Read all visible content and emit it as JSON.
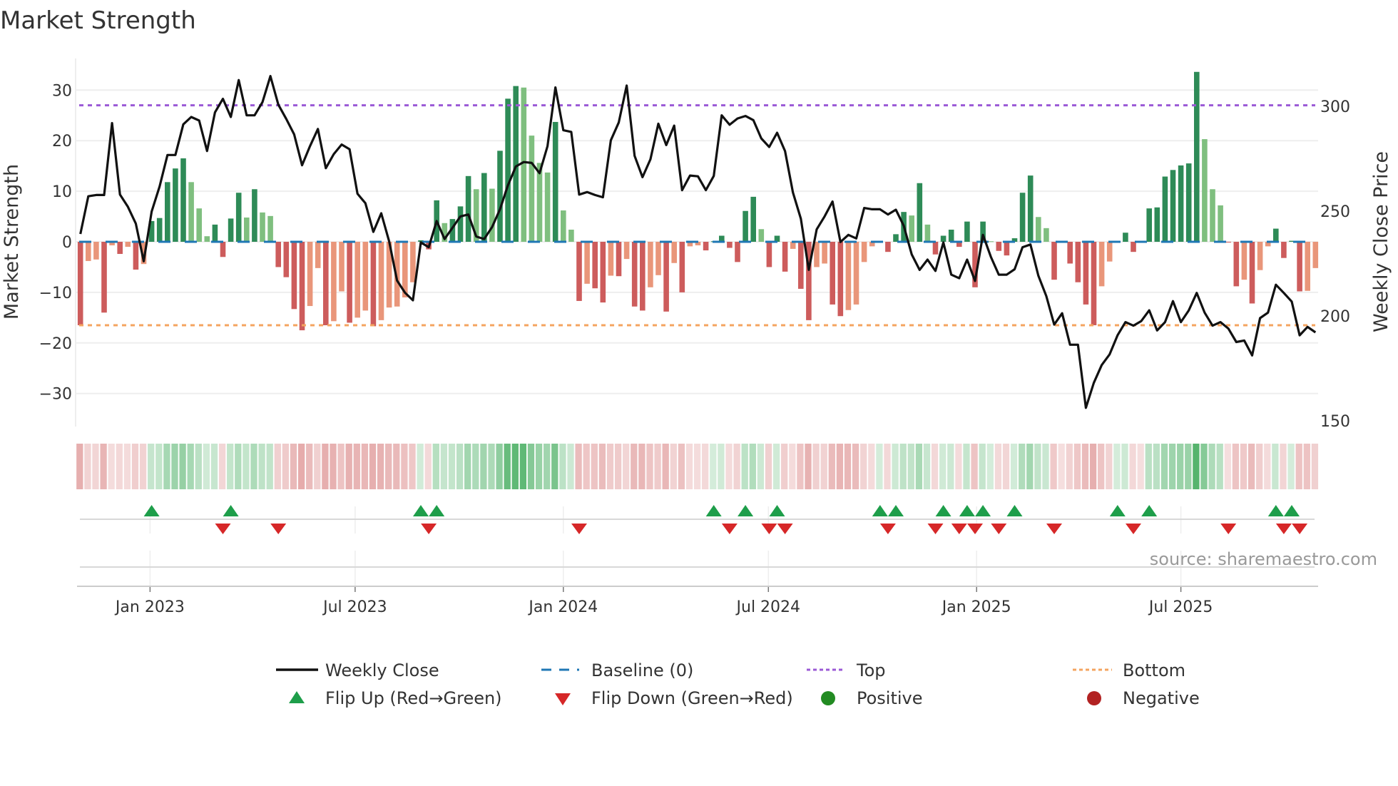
{
  "title": "Market Strength",
  "source": "source: sharemaestro.com",
  "colors": {
    "price": "#111111",
    "baseline": "#1f77b4",
    "top": "#9b59d6",
    "bottom": "#f4a460",
    "pos_strong": "#2e8b57",
    "pos_weak": "#7fbf7f",
    "neg_strong": "#cd5c5c",
    "neg_weak": "#e9967a",
    "flip_up": "#1e9e4a",
    "flip_down": "#d62728",
    "positive": "#228b22",
    "negative": "#b22222",
    "grid": "#eeeeee"
  },
  "legend": {
    "weekly_close": "Weekly Close",
    "baseline": "Baseline (0)",
    "top": "Top",
    "bottom": "Bottom",
    "flip_up": "Flip Up (Red→Green)",
    "flip_down": "Flip Down (Green→Red)",
    "positive": "Positive",
    "negative": "Negative"
  },
  "chart_data": {
    "type": "bar",
    "title": "Market Strength",
    "ylabel": "Market Strength",
    "y2label": "Weekly Close Price",
    "ylim": [
      -35,
      36
    ],
    "y2lim": [
      145,
      325
    ],
    "yticks": [
      "30",
      "20",
      "10",
      "0",
      "−10",
      "−20",
      "−30"
    ],
    "ytick_values": [
      30,
      20,
      10,
      0,
      -10,
      -20,
      -30
    ],
    "y2ticks": [
      "300",
      "250",
      "200",
      "150"
    ],
    "y2tick_values": [
      300,
      250,
      200,
      150
    ],
    "grid": true,
    "legend_placement": "bottom",
    "top_level": 27,
    "bottom_level": -16.5,
    "baseline": 0,
    "x_unit": "week index (weekly, ~Nov 2022 to Oct 2025)",
    "xticks": [
      {
        "label": "Jan 2023",
        "week": 8.8
      },
      {
        "label": "Jul 2023",
        "week": 34.7
      },
      {
        "label": "Jan 2024",
        "week": 61.0
      },
      {
        "label": "Jul 2024",
        "week": 86.9
      },
      {
        "label": "Jan 2025",
        "week": 113.2
      },
      {
        "label": "Jul 2025",
        "week": 139.0
      }
    ],
    "strength": [
      -16.5,
      -3.8,
      -3.5,
      -14,
      -0.7,
      -2.4,
      -1,
      -5.5,
      -4.4,
      4.1,
      4.7,
      11.8,
      14.5,
      16.5,
      11.8,
      6.6,
      1.1,
      3.4,
      -3,
      4.6,
      9.7,
      4.8,
      10.4,
      5.8,
      5.1,
      -5,
      -7,
      -13.3,
      -17.5,
      -12.7,
      -5.2,
      -16.5,
      -15.7,
      -9.8,
      -16,
      -15,
      -13.6,
      -16.7,
      -15.5,
      -13,
      -12.8,
      -11,
      -8,
      0.3,
      -1.5,
      8.2,
      3.7,
      4.5,
      7,
      13,
      10.4,
      13.6,
      10.5,
      18,
      28.3,
      30.8,
      30.5,
      21,
      15.6,
      13.7,
      23.7,
      6.2,
      2.4,
      -11.7,
      -8.3,
      -9.2,
      -12,
      -6.7,
      -6.8,
      -3.4,
      -12.8,
      -13.6,
      -9,
      -6.6,
      -13.8,
      -4.2,
      -10,
      -0.9,
      -0.7,
      -1.7,
      0.1,
      1.2,
      -1.2,
      -4,
      6.1,
      8.9,
      2.5,
      -5,
      1.2,
      -5.9,
      -1.4,
      -9.3,
      -15.5,
      -5,
      -4.3,
      -12.4,
      -14.7,
      -13.5,
      -12.4,
      -4,
      -0.9,
      0.2,
      -2,
      1.5,
      5.9,
      5.2,
      11.6,
      3.4,
      -2.5,
      1.2,
      2.4,
      -1,
      4,
      -9,
      4,
      0.1,
      -1.8,
      -2.7,
      0.7,
      9.7,
      13.1,
      4.9,
      2.7,
      -7.5,
      -0.1,
      -4.3,
      -8,
      -12.4,
      -16.5,
      -8.8,
      -3.9,
      0.1,
      1.8,
      -2,
      -0.1,
      6.6,
      6.8,
      12.9,
      14.2,
      15.1,
      15.5,
      33.6,
      20.3,
      10.4,
      7.2,
      -0.1,
      -8.8,
      -7.5,
      -12.2,
      -5.6,
      -0.9,
      2.6,
      -3.2,
      0.2,
      -9.8,
      -9.7,
      -5.2
    ],
    "weekly_close": [
      239,
      257,
      257.6,
      257.6,
      291.9,
      257.8,
      252,
      244,
      226,
      249.7,
      261.6,
      276.7,
      276.7,
      291.3,
      294.8,
      293.1,
      278.6,
      297,
      303.5,
      294.8,
      312.4,
      295.6,
      295.6,
      301.9,
      314.3,
      300.7,
      293.9,
      286.5,
      271.8,
      280.9,
      289.1,
      270.4,
      277.1,
      281.7,
      279.4,
      258.2,
      253.7,
      240,
      248.9,
      235.5,
      216.8,
      211,
      207.4,
      235,
      232.7,
      245.2,
      236.6,
      242,
      247.4,
      248.3,
      237.8,
      236.6,
      242.3,
      250.8,
      262.2,
      271.2,
      273.3,
      272.9,
      268,
      280.9,
      308.9,
      288.5,
      287.7,
      257.8,
      259,
      257.6,
      256.5,
      283.7,
      292.2,
      309.8,
      276.3,
      266.1,
      274.6,
      291.6,
      281.4,
      290.7,
      259.9,
      266.9,
      266.5,
      259.9,
      266.7,
      295.6,
      291.1,
      294.1,
      295.3,
      293.3,
      284.6,
      280.5,
      287.3,
      278.6,
      258.8,
      246.3,
      221.9,
      241.2,
      247.4,
      254.5,
      235.2,
      238.6,
      236.9,
      251.4,
      250.8,
      250.8,
      248.3,
      250.6,
      242.9,
      229.3,
      221.9,
      226.8,
      221.4,
      235,
      219.6,
      217.9,
      226.8,
      216.6,
      238.6,
      228.1,
      219.6,
      219.6,
      222.2,
      232.7,
      234,
      219.1,
      209.4,
      195.8,
      201.2,
      186.2,
      186.2,
      156.1,
      168,
      176.5,
      181.6,
      190.7,
      197,
      195.3,
      197.5,
      202.6,
      193,
      197,
      207,
      197,
      202.6,
      210.9,
      201.5,
      195.3,
      197,
      193.9,
      187.5,
      188.2,
      181.1,
      198.9,
      201.5,
      214.8,
      210.9,
      206.8,
      190.7,
      194.7,
      192.1
    ],
    "flip_up_weeks": [
      9,
      19,
      43,
      45,
      80,
      84,
      88,
      101,
      103,
      109,
      112,
      114,
      118,
      131,
      135,
      151,
      153
    ],
    "flip_down_weeks": [
      18,
      25,
      44,
      63,
      82,
      87,
      89,
      102,
      108,
      111,
      113,
      116,
      123,
      133,
      145,
      152,
      154
    ]
  }
}
